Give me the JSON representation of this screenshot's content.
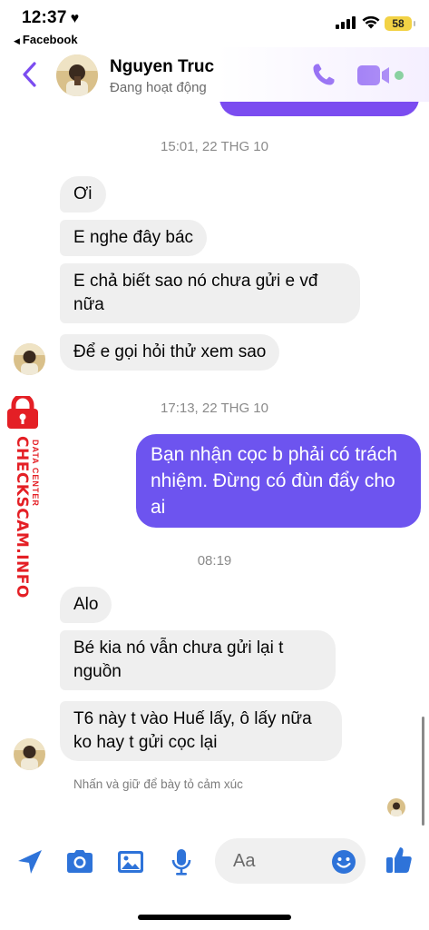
{
  "status_bar": {
    "time": "12:37",
    "heart": "♥",
    "back_app": "Facebook",
    "battery": "58"
  },
  "header": {
    "contact_name": "Nguyen Truc",
    "contact_status": "Đang hoạt động"
  },
  "accent_color": "#7b4cf0",
  "messages": [
    {
      "type": "timestamp",
      "text": "15:01, 22 THG 10"
    },
    {
      "type": "incoming",
      "text": "Ơi"
    },
    {
      "type": "incoming",
      "text": "E nghe đây bác"
    },
    {
      "type": "incoming",
      "text": "E chả biết sao nó chưa gửi e vđ nữa"
    },
    {
      "type": "incoming",
      "text": "Để e gọi hỏi thử xem sao"
    },
    {
      "type": "timestamp",
      "text": "17:13, 22 THG 10"
    },
    {
      "type": "outgoing",
      "text": "Bạn nhận cọc b phải có trách nhiệm. Đừng có đùn đẩy cho ai"
    },
    {
      "type": "timestamp",
      "text": "08:19"
    },
    {
      "type": "incoming",
      "text": "Alo"
    },
    {
      "type": "incoming",
      "text": "Bé kia nó vẫn chưa gửi lại t nguồn"
    },
    {
      "type": "incoming",
      "text": "T6 này t vào Huế lấy, ô lấy nữa ko hay t gửi cọc lại"
    }
  ],
  "hint": "Nhấn và giữ để bày tỏ cảm xúc",
  "watermark": {
    "main": "CHECKSCAM.INFO",
    "sub": "DATA CENTER"
  },
  "composer": {
    "placeholder": "Aa"
  },
  "icons": [
    "chevron-left-icon",
    "phone-icon",
    "video-icon",
    "location-arrow-icon",
    "camera-icon",
    "image-icon",
    "microphone-icon",
    "emoji-icon",
    "like-icon"
  ]
}
